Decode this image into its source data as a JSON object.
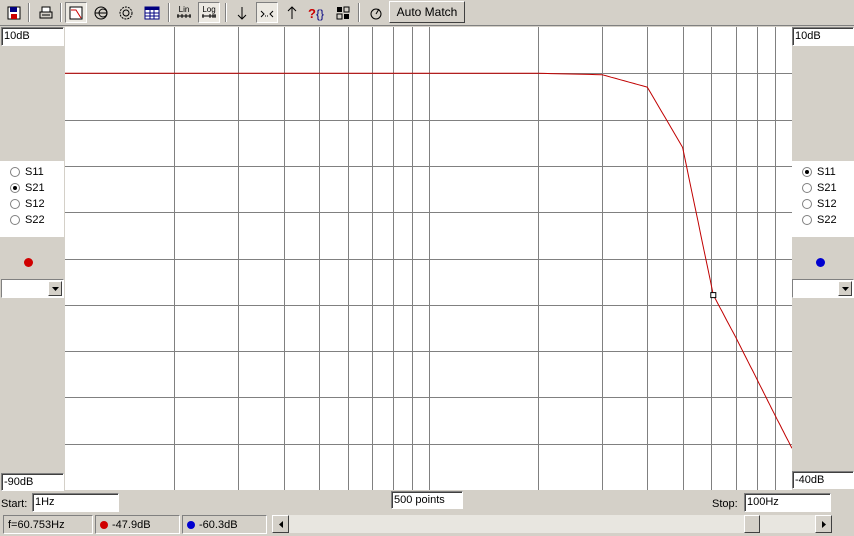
{
  "toolbar": {
    "icons": [
      "save-icon",
      "print-icon",
      "chart-icon",
      "smith-chart-icon",
      "polar-chart-icon",
      "table-icon",
      "linear-scale-icon",
      "log-scale-icon",
      "marker-down-icon",
      "zoom-in-icon",
      "marker-up-icon",
      "help-icon",
      "gear-icon",
      "tune-icon"
    ],
    "lin_label": "Lin",
    "log_label": "Log",
    "auto_match_label": "Auto Match"
  },
  "left_panel": {
    "top_value": "10dB",
    "bottom_value": "-90dB",
    "params": [
      "S11",
      "S21",
      "S12",
      "S22"
    ],
    "selected": "S21",
    "marker_color": "#d00000",
    "combo_value": ""
  },
  "right_panel": {
    "top_value": "10dB",
    "bottom_value": "-40dB",
    "params": [
      "S11",
      "S21",
      "S12",
      "S22"
    ],
    "selected": "S11",
    "marker_color": "#0000d0",
    "combo_value": ""
  },
  "sweep": {
    "start_label": "Start:",
    "start_value": "1Hz",
    "points": "500 points",
    "stop_label": "Stop:",
    "stop_value": "100Hz"
  },
  "status": {
    "frequency": "f=60.753Hz",
    "red_value": "-47.9dB",
    "blue_value": "-60.3dB"
  },
  "chart_data": {
    "type": "line",
    "series": [
      {
        "color": "#c00000",
        "x": [
          1,
          10,
          20,
          30,
          40,
          50,
          60.753,
          70,
          80,
          90,
          100
        ],
        "y": [
          0,
          0,
          0,
          -0.3,
          -3,
          -16,
          -47.9,
          -57,
          -66,
          -74,
          -81
        ]
      }
    ],
    "xlim": [
      1,
      100
    ],
    "ylim": [
      -90,
      10
    ],
    "x_scale": "linear",
    "grid": true,
    "marker": {
      "x": 60.753,
      "y": -47.9
    }
  },
  "colors": {
    "trace": "#c00000",
    "grid": "#808080",
    "background": "#ffffff"
  }
}
